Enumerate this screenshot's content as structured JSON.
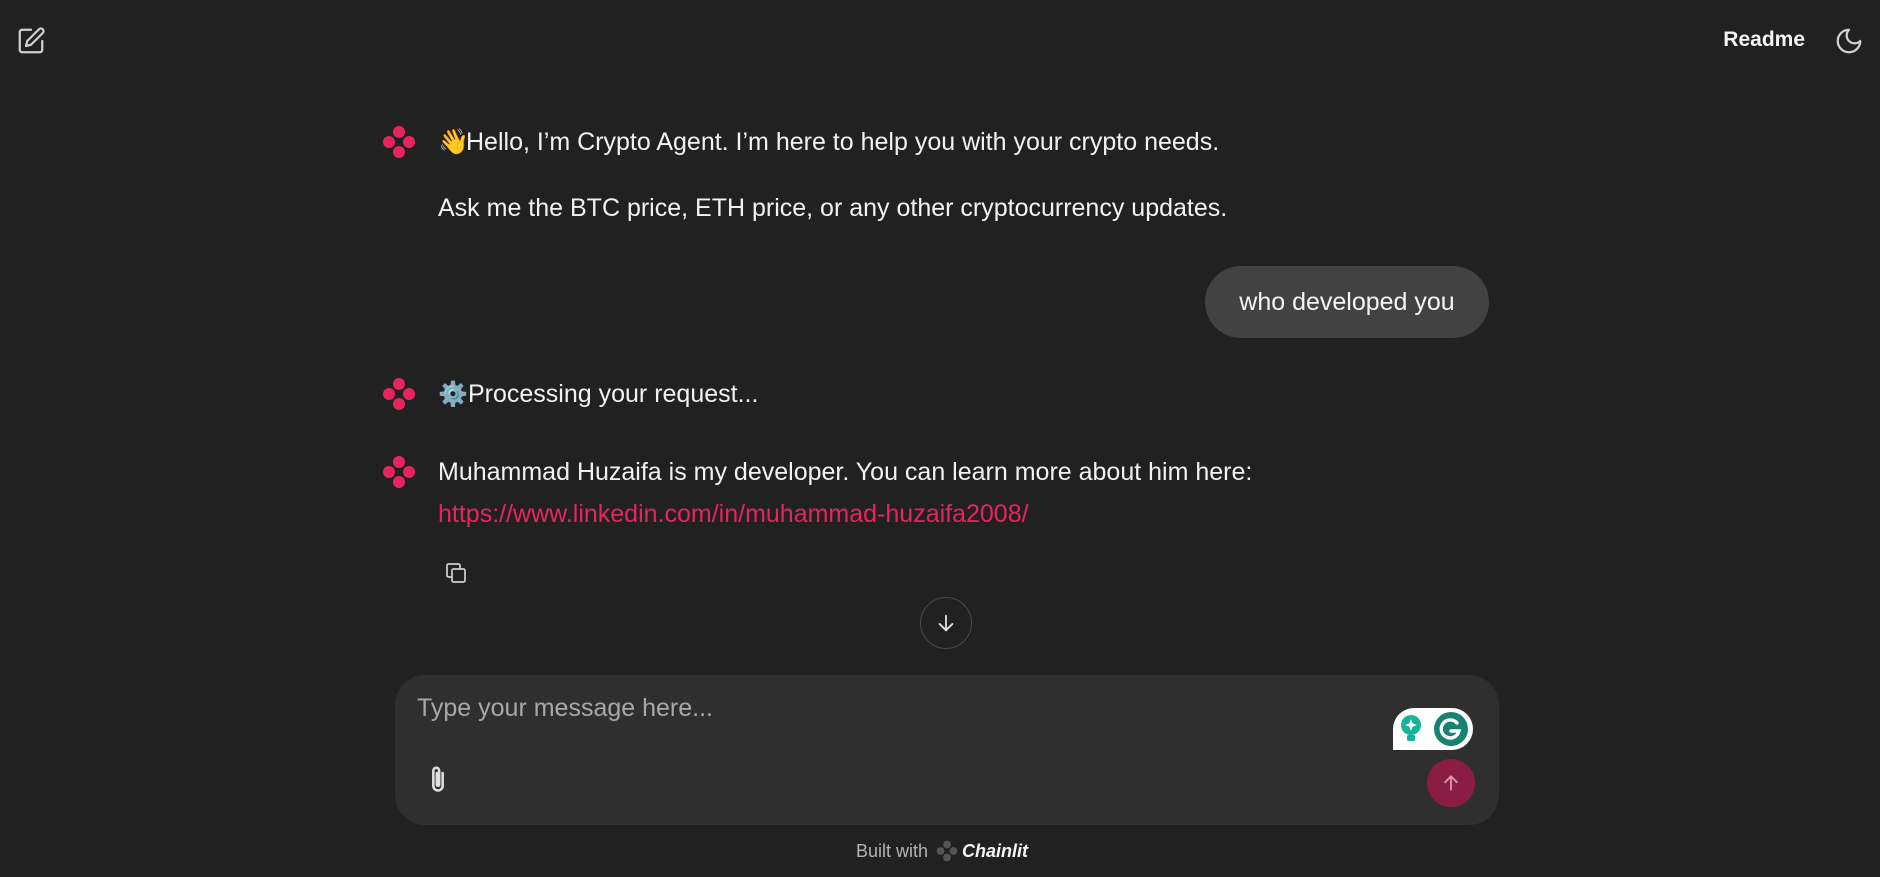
{
  "topbar": {
    "new_chat_icon": "edit-square-icon",
    "readme_label": "Readme",
    "theme_icon": "moon-icon"
  },
  "messages": [
    {
      "role": "assistant",
      "emoji": "👋",
      "line1": "Hello, I’m Crypto Agent. I’m here to help you with your crypto needs.",
      "line2": "Ask me the BTC price, ETH price, or any other cryptocurrency updates."
    },
    {
      "role": "user",
      "text": "who developed you"
    },
    {
      "role": "assistant",
      "emoji": "⚙️",
      "text": "Processing your request..."
    },
    {
      "role": "assistant",
      "text": "Muhammad Huzaifa is my developer. You can learn more about him here:",
      "link": "https://www.linkedin.com/in/muhammad-huzaifa2008/"
    }
  ],
  "composer": {
    "placeholder": "Type your message here..."
  },
  "footer": {
    "built_with": "Built with",
    "brand": "Chainlit"
  },
  "colors": {
    "background": "#212121",
    "accent": "#e8245f",
    "send_button": "#8b1d44",
    "user_bubble": "#424242",
    "composer": "#2f2f2f"
  }
}
